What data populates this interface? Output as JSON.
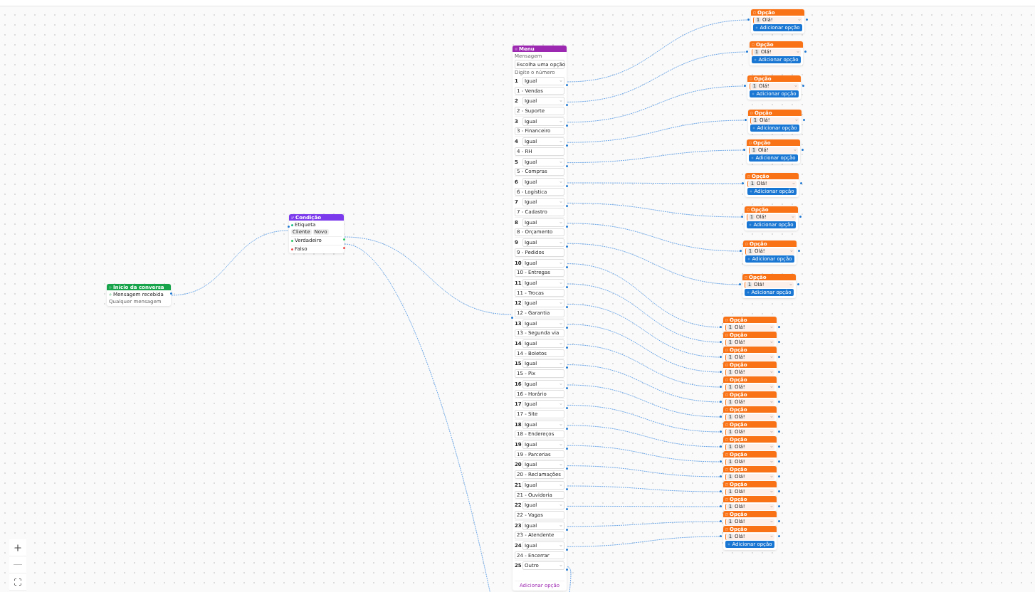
{
  "start": {
    "title": "Início da conversa",
    "trigger": "Mensagem recebida",
    "detail": "Qualquer mensagem"
  },
  "condition": {
    "title": "Condição",
    "field": "Etiqueta",
    "tags": [
      "Cliente",
      "Novo"
    ],
    "outputs": [
      {
        "label": "Verdadeiro",
        "kind": "true"
      },
      {
        "label": "Falso",
        "kind": "false"
      }
    ]
  },
  "menu": {
    "title": "Menu",
    "label": "Mensagem",
    "message": "Escolha uma opção",
    "hint": "Digite o número",
    "add": "Adicionar opção",
    "options": [
      {
        "number": "1",
        "operator": "Igual",
        "value": "1 - Vendas"
      },
      {
        "number": "2",
        "operator": "Igual",
        "value": "2 - Suporte"
      },
      {
        "number": "3",
        "operator": "Igual",
        "value": "3 - Financeiro"
      },
      {
        "number": "4",
        "operator": "Igual",
        "value": "4 - RH"
      },
      {
        "number": "5",
        "operator": "Igual",
        "value": "5 - Compras"
      },
      {
        "number": "6",
        "operator": "Igual",
        "value": "6 - Logística"
      },
      {
        "number": "7",
        "operator": "Igual",
        "value": "7 - Cadastro"
      },
      {
        "number": "8",
        "operator": "Igual",
        "value": "8 - Orçamento"
      },
      {
        "number": "9",
        "operator": "Igual",
        "value": "9 - Pedidos"
      },
      {
        "number": "10",
        "operator": "Igual",
        "value": "10 - Entregas"
      },
      {
        "number": "11",
        "operator": "Igual",
        "value": "11 - Trocas"
      },
      {
        "number": "12",
        "operator": "Igual",
        "value": "12 - Garantia"
      },
      {
        "number": "13",
        "operator": "Igual",
        "value": "13 - Segunda via"
      },
      {
        "number": "14",
        "operator": "Igual",
        "value": "14 - Boletos"
      },
      {
        "number": "15",
        "operator": "Igual",
        "value": "15 - Pix"
      },
      {
        "number": "16",
        "operator": "Igual",
        "value": "16 - Horário"
      },
      {
        "number": "17",
        "operator": "Igual",
        "value": "17 - Site"
      },
      {
        "number": "18",
        "operator": "Igual",
        "value": "18 - Endereços"
      },
      {
        "number": "19",
        "operator": "Igual",
        "value": "19 - Parcerias"
      },
      {
        "number": "20",
        "operator": "Igual",
        "value": "20 - Reclamações"
      },
      {
        "number": "21",
        "operator": "Igual",
        "value": "21 - Ouvidoria"
      },
      {
        "number": "22",
        "operator": "Igual",
        "value": "22 - Vagas"
      },
      {
        "number": "23",
        "operator": "Igual",
        "value": "23 - Atendente"
      },
      {
        "number": "24",
        "operator": "Igual",
        "value": "24 - Encerrar"
      },
      {
        "number": "25",
        "operator": "Outro"
      }
    ]
  },
  "replies": [
    {
      "title": "Opção",
      "number": "1",
      "text": "Olá!",
      "button": "Adicionar opção"
    },
    {
      "title": "Opção",
      "number": "1",
      "text": "Olá!",
      "button": "Adicionar opção"
    },
    {
      "title": "Opção",
      "number": "1",
      "text": "Olá!",
      "button": "Adicionar opção"
    },
    {
      "title": "Opção",
      "number": "1",
      "text": "Olá!",
      "button": "Adicionar opção"
    },
    {
      "title": "Opção",
      "number": "1",
      "text": "Olá!",
      "button": "Adicionar opção"
    },
    {
      "title": "Opção",
      "number": "1",
      "text": "Olá!",
      "button": "Adicionar opção"
    },
    {
      "title": "Opção",
      "number": "1",
      "text": "Olá!",
      "button": "Adicionar opção"
    },
    {
      "title": "Opção",
      "number": "1",
      "text": "Olá!",
      "button": "Adicionar opção"
    },
    {
      "title": "Opção",
      "number": "1",
      "text": "Olá!",
      "button": "Adicionar opção"
    },
    {
      "title": "Opção",
      "number": "1",
      "text": "Olá!"
    },
    {
      "title": "Opção",
      "number": "1",
      "text": "Olá!"
    },
    {
      "title": "Opção",
      "number": "1",
      "text": "Olá!"
    },
    {
      "title": "Opção",
      "number": "1",
      "text": "Olá!"
    },
    {
      "title": "Opção",
      "number": "1",
      "text": "Olá!"
    },
    {
      "title": "Opção",
      "number": "1",
      "text": "Olá!"
    },
    {
      "title": "Opção",
      "number": "1",
      "text": "Olá!"
    },
    {
      "title": "Opção",
      "number": "1",
      "text": "Olá!"
    },
    {
      "title": "Opção",
      "number": "1",
      "text": "Olá!"
    },
    {
      "title": "Opção",
      "number": "1",
      "text": "Olá!"
    },
    {
      "title": "Opção",
      "number": "1",
      "text": "Olá!"
    },
    {
      "title": "Opção",
      "number": "1",
      "text": "Olá!"
    },
    {
      "title": "Opção",
      "number": "1",
      "text": "Olá!"
    },
    {
      "title": "Opção",
      "number": "1",
      "text": "Olá!"
    },
    {
      "title": "Opção",
      "number": "1",
      "text": "Olá!",
      "button": "Adicionar opção"
    }
  ]
}
